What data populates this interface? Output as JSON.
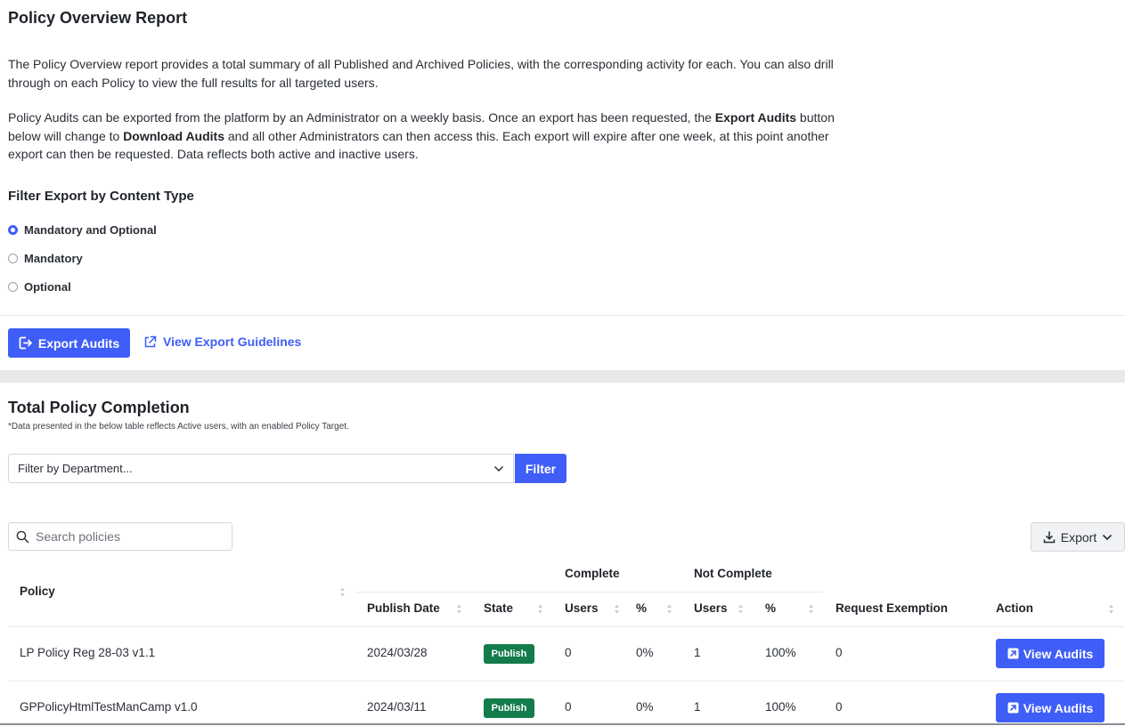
{
  "page": {
    "title": "Policy Overview Report",
    "para1": "The Policy Overview report provides a total summary of all Published and Archived Policies, with the corresponding activity for each. You can also drill through on each Policy to view the full results for all targeted users.",
    "para2_a": "Policy Audits can be exported from the platform by an Administrator on a weekly basis. Once an export has been requested, the ",
    "para2_b": "Export Audits",
    "para2_c": " button below will change to ",
    "para2_d": "Download Audits",
    "para2_e": " and all other Administrators can then access this. Each export will expire after one week, at this point another export can then be requested. Data reflects both active and inactive users."
  },
  "filter_export": {
    "heading": "Filter Export by Content Type",
    "options": [
      {
        "label": "Mandatory and Optional",
        "checked": true
      },
      {
        "label": "Mandatory",
        "checked": false
      },
      {
        "label": "Optional",
        "checked": false
      }
    ]
  },
  "actions": {
    "export_label": "Export Audits",
    "guidelines_label": "View Export Guidelines"
  },
  "completion": {
    "title": "Total Policy Completion",
    "note": "*Data presented in the below table reflects Active users, with an enabled Policy Target.",
    "department_placeholder": "Filter by Department...",
    "filter_label": "Filter",
    "search_placeholder": "Search policies",
    "export_dropdown_label": "Export"
  },
  "table": {
    "group_complete": "Complete",
    "group_not_complete": "Not Complete",
    "headers": {
      "policy": "Policy",
      "publish_date": "Publish Date",
      "state": "State",
      "c_users": "Users",
      "c_pct": "%",
      "nc_users": "Users",
      "nc_pct": "%",
      "exemption": "Request Exemption",
      "action": "Action"
    },
    "rows": [
      {
        "policy": "LP Policy Reg 28-03 v1.1",
        "publish_date": "2024/03/28",
        "state": "Publish",
        "c_users": "0",
        "c_pct": "0%",
        "nc_users": "1",
        "nc_pct": "100%",
        "exemption": "0",
        "action": "View Audits"
      },
      {
        "policy": "GPPolicyHtmlTestManCamp v1.0",
        "publish_date": "2024/03/11",
        "state": "Publish",
        "c_users": "0",
        "c_pct": "0%",
        "nc_users": "1",
        "nc_pct": "100%",
        "exemption": "0",
        "action": "View Audits"
      }
    ]
  },
  "colors": {
    "accent": "#3f5ef7",
    "publish_badge": "#137c4a"
  },
  "icons": [
    "export-icon",
    "external-link-icon",
    "chevron-down-icon",
    "search-icon",
    "download-icon",
    "open-icon",
    "sort-icon"
  ]
}
